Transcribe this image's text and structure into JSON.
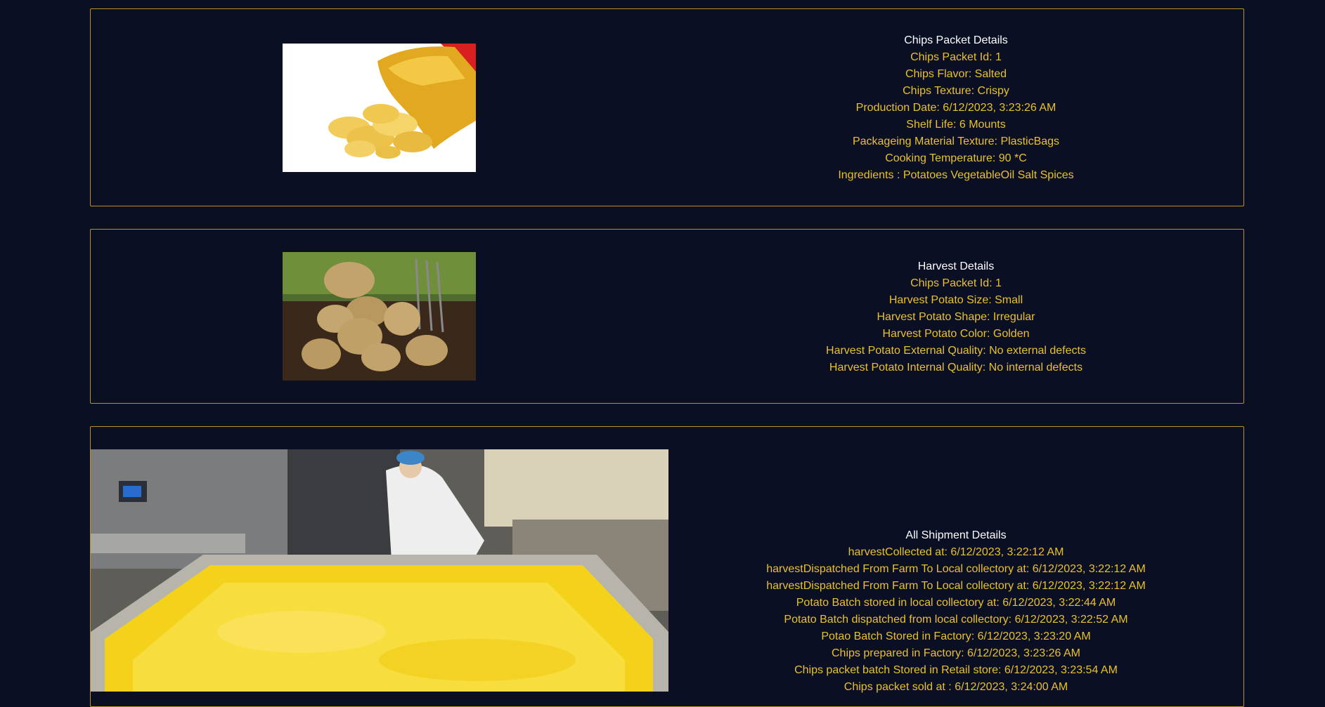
{
  "colors": {
    "background": "#0a0f24",
    "card_border": "#b8902c",
    "text_accent": "#e9c12e",
    "heading": "#ffffff"
  },
  "chips_packet": {
    "heading": "Chips Packet Details",
    "lines": [
      "Chips Packet Id: 1",
      "Chips Flavor: Salted",
      "Chips Texture: Crispy",
      "Production Date: 6/12/2023, 3:23:26 AM",
      "Shelf Life: 6 Mounts",
      "Packageing Material Texture: PlasticBags",
      "Cooking Temperature: 90 *C",
      "Ingredients : Potatoes VegetableOil Salt Spices"
    ]
  },
  "harvest": {
    "heading": "Harvest Details",
    "lines": [
      "Chips Packet Id: 1",
      "Harvest Potato Size: Small",
      "Harvest Potato Shape: Irregular",
      "Harvest Potato Color: Golden",
      "Harvest Potato External Quality: No external defects",
      "Harvest Potato Internal Quality: No internal defects"
    ]
  },
  "shipment": {
    "heading": "All Shipment Details",
    "lines": [
      "harvestCollected at: 6/12/2023, 3:22:12 AM",
      "harvestDispatched From Farm To Local collectory at: 6/12/2023, 3:22:12 AM",
      "harvestDispatched From Farm To Local collectory at: 6/12/2023, 3:22:12 AM",
      "Potato Batch stored in local collectory at: 6/12/2023, 3:22:44 AM",
      "Potato Batch dispatched from local collectory: 6/12/2023, 3:22:52 AM",
      "Potao Batch Stored in Factory: 6/12/2023, 3:23:20 AM",
      "Chips prepared in Factory: 6/12/2023, 3:23:26 AM",
      "Chips packet batch Stored in Retail store: 6/12/2023, 3:23:54 AM",
      "Chips packet sold at : 6/12/2023, 3:24:00 AM"
    ]
  }
}
